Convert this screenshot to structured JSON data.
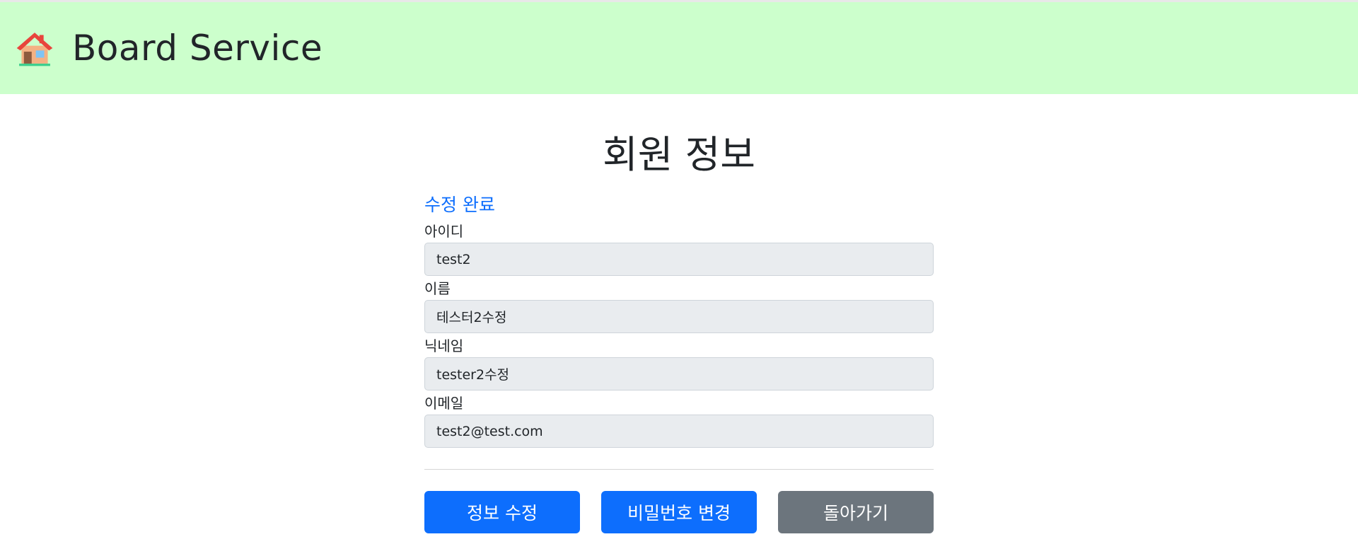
{
  "header": {
    "icon": "house-icon",
    "brand": "Board Service",
    "colors": {
      "background": "#ccffcc"
    }
  },
  "page": {
    "title": "회원 정보",
    "status_message": "수정 완료"
  },
  "form": {
    "fields": [
      {
        "label": "아이디",
        "value": "test2"
      },
      {
        "label": "이름",
        "value": "테스터2수정"
      },
      {
        "label": "닉네임",
        "value": "tester2수정"
      },
      {
        "label": "이메일",
        "value": "test2@test.com"
      }
    ]
  },
  "actions": {
    "edit_label": "정보 수정",
    "change_password_label": "비밀번호 변경",
    "back_label": "돌아가기",
    "colors": {
      "primary": "#0d6efd",
      "secondary": "#6c757d",
      "status": "#0d6efd"
    }
  }
}
